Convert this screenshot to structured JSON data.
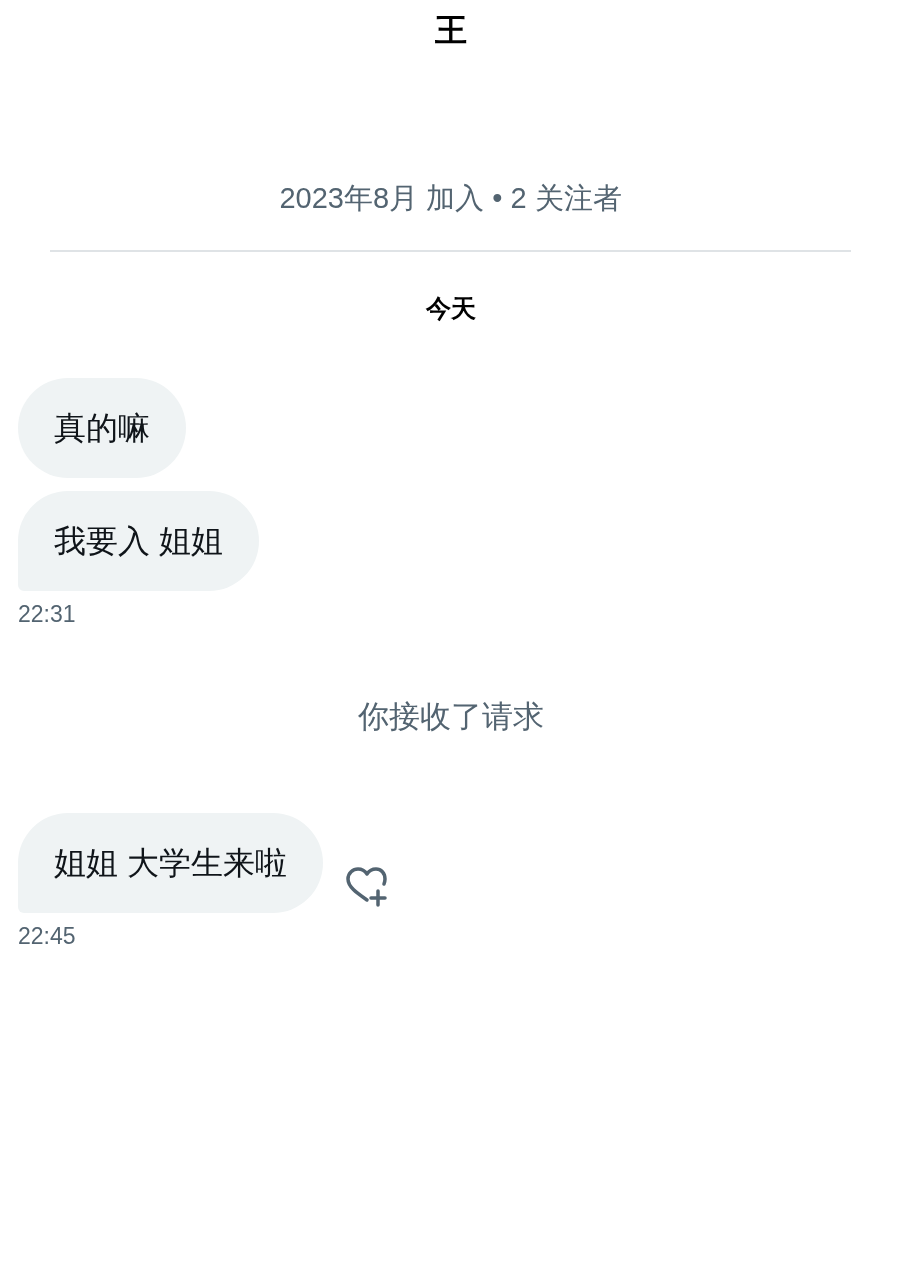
{
  "header": {
    "title": "王",
    "meta": "2023年8月 加入 • 2 关注者"
  },
  "day_label": "今天",
  "items": [
    {
      "kind": "bubble",
      "text": "真的嘛",
      "tail": false,
      "react_icon": false
    },
    {
      "kind": "bubble",
      "text": "我要入 姐姐",
      "tail": true,
      "react_icon": false
    },
    {
      "kind": "time",
      "text": "22:31"
    },
    {
      "kind": "notice",
      "text": "你接收了请求"
    },
    {
      "kind": "bubble",
      "text": "姐姐 大学生来啦",
      "tail": true,
      "react_icon": true
    },
    {
      "kind": "time",
      "text": "22:45"
    }
  ]
}
